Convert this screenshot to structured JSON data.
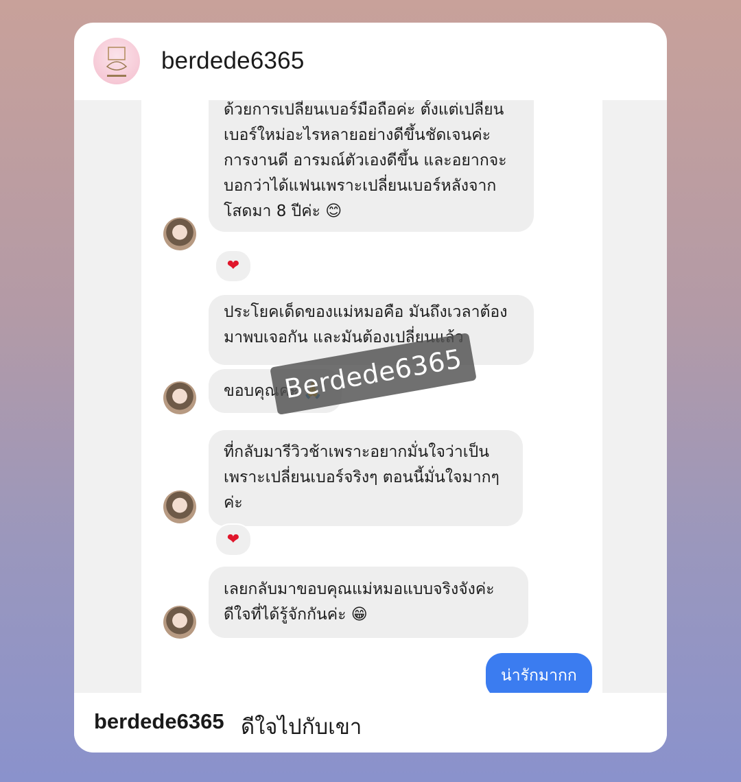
{
  "post": {
    "username": "berdede6365"
  },
  "messages": [
    {
      "lines": [
        "ด้วยการเปลี่ยนเบอร์มือถือค่ะ ตั้งแต่เปลี่ยน",
        "เบอร์ใหม่อะไรหลายอย่างดีขึ้นชัดเจนค่ะ",
        "การงานดี อารมณ์ตัวเองดีขึ้น และอยากจะ",
        "บอกว่าได้แฟนเพราะเปลี่ยนเบอร์หลังจาก",
        "โสดมา 8 ปีค่ะ 😊"
      ],
      "reaction": "❤"
    },
    {
      "lines": [
        "ประโยคเด็ดของแม่หมอคือ มันถึงเวลาต้อง",
        "มาพบเจอกัน และมันต้องเปลี่ยนแล้ว"
      ]
    },
    {
      "lines": [
        "ขอบคุณค่ะ 🙏"
      ]
    },
    {
      "lines": [
        "ที่กลับมารีวิวช้าเพราะอยากมั่นใจว่าเป็น",
        "เพราะเปลี่ยนเบอร์จริงๆ ตอนนี้มั่นใจมากๆ",
        "ค่ะ"
      ],
      "reaction": "❤"
    },
    {
      "lines": [
        "เลยกลับมาขอบคุณแม่หมอแบบจริงจังค่ะ",
        "ดีใจที่ได้รู้จักกันค่ะ 😁"
      ]
    }
  ],
  "sent_message": "น่ารักมากก",
  "watermark": "Berdede6365",
  "caption": {
    "username": "berdede6365",
    "text": "ดีใจไปกับเขา"
  },
  "colors": {
    "sent_bubble": "#3b7cf0",
    "received_bubble": "#eeeeee",
    "heart": "#e0162b"
  }
}
